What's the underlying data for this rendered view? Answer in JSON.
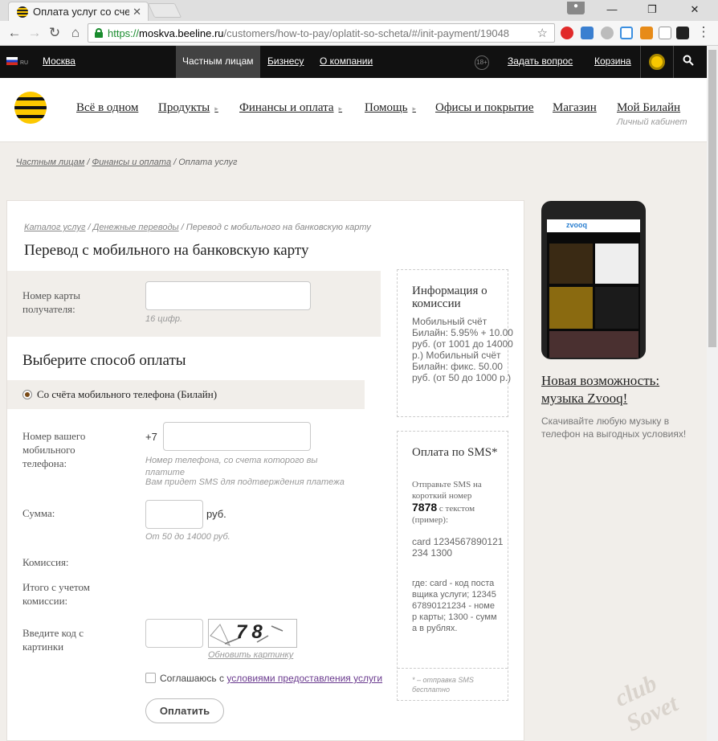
{
  "browser": {
    "tab_title": "Оплата услуг со сче",
    "tab_close": "✕",
    "url_scheme": "https://",
    "url_host": "moskva.beeline.ru",
    "url_path": "/customers/how-to-pay/oplatit-so-scheta/#/init-payment/19048",
    "win_min": "—",
    "win_max": "❐",
    "win_close": "✕"
  },
  "topbar": {
    "region_code": "RU",
    "city": "Москва",
    "tabs": [
      "Частным лицам",
      "Бизнесу",
      "О компании"
    ],
    "age": "18+",
    "ask": "Задать вопрос",
    "cart": "Корзина"
  },
  "header": {
    "nav": [
      "Всё в одном",
      "Продукты",
      "Финансы и оплата",
      "Помощь",
      "Офисы и покрытие",
      "Магазин",
      "Мой Билайн"
    ],
    "caret": "▸",
    "my_beeline_sub": "Личный кабинет"
  },
  "breadcrumbs": [
    "Частным лицам",
    "Финансы и оплата",
    "Оплата услуг"
  ],
  "card": {
    "subcrumbs": [
      "Каталог услуг",
      "Денежные переводы",
      "Перевод с мобильного на банковскую карту"
    ],
    "title": "Перевод с мобильного на банковскую карту",
    "card_number_label": "Номер карты получателя:",
    "card_number_hint": "16 цифр.",
    "method_title": "Выберите способ оплаты",
    "method_option": "Со счёта мобильного телефона (Билайн)",
    "phone_label": "Номер вашего мобильного телефона:",
    "phone_prefix": "+7",
    "phone_hint1": "Номер телефона, со счета которого вы платите",
    "phone_hint2": "Вам придет SMS для подтверждения платежа",
    "sum_label": "Сумма:",
    "sum_currency": "руб.",
    "sum_hint": "От 50 до 14000 руб.",
    "commission_label": "Комиссия:",
    "total_label": "Итого с учетом комиссии:",
    "captcha_label": "Введите код с картинки",
    "captcha_text": "78",
    "captcha_refresh": "Обновить картинку",
    "agree_prefix": "Соглашаюсь с",
    "agree_link": "условиями предоставления услуги",
    "pay_button": "Оплатить"
  },
  "commission_box": {
    "title": "Информация о комиссии",
    "text": "Мобильный счёт Билайн: 5.95% + 10.00 руб. (от 1001 до 14000 р.) Мобильный счёт Билайн: фикс. 50.00 руб. (от 50 до 1000 р.)"
  },
  "sms_box": {
    "title": "Оплата по SMS*",
    "intro": "Отправьте SMS на короткий номер",
    "number": "7878",
    "after_number": "с текстом (пример):",
    "example": "card 1234567890121234 1300",
    "explain": "где: card - код поставщика услуги; 1234567890121234 - номер карты; 1300 - сумма в рублях.",
    "footnote": "* – отправка SMS бесплатно"
  },
  "ad": {
    "app_name": "zvooq",
    "title": "Новая возможность: музыка Zvooq!",
    "text": "Скачивайте любую музыку в телефон на выгодных условиях!"
  },
  "watermark": "club Sovet",
  "colors": {
    "brand_yellow": "#fcc800",
    "topbar_bg": "#111111",
    "link": "#222222"
  }
}
